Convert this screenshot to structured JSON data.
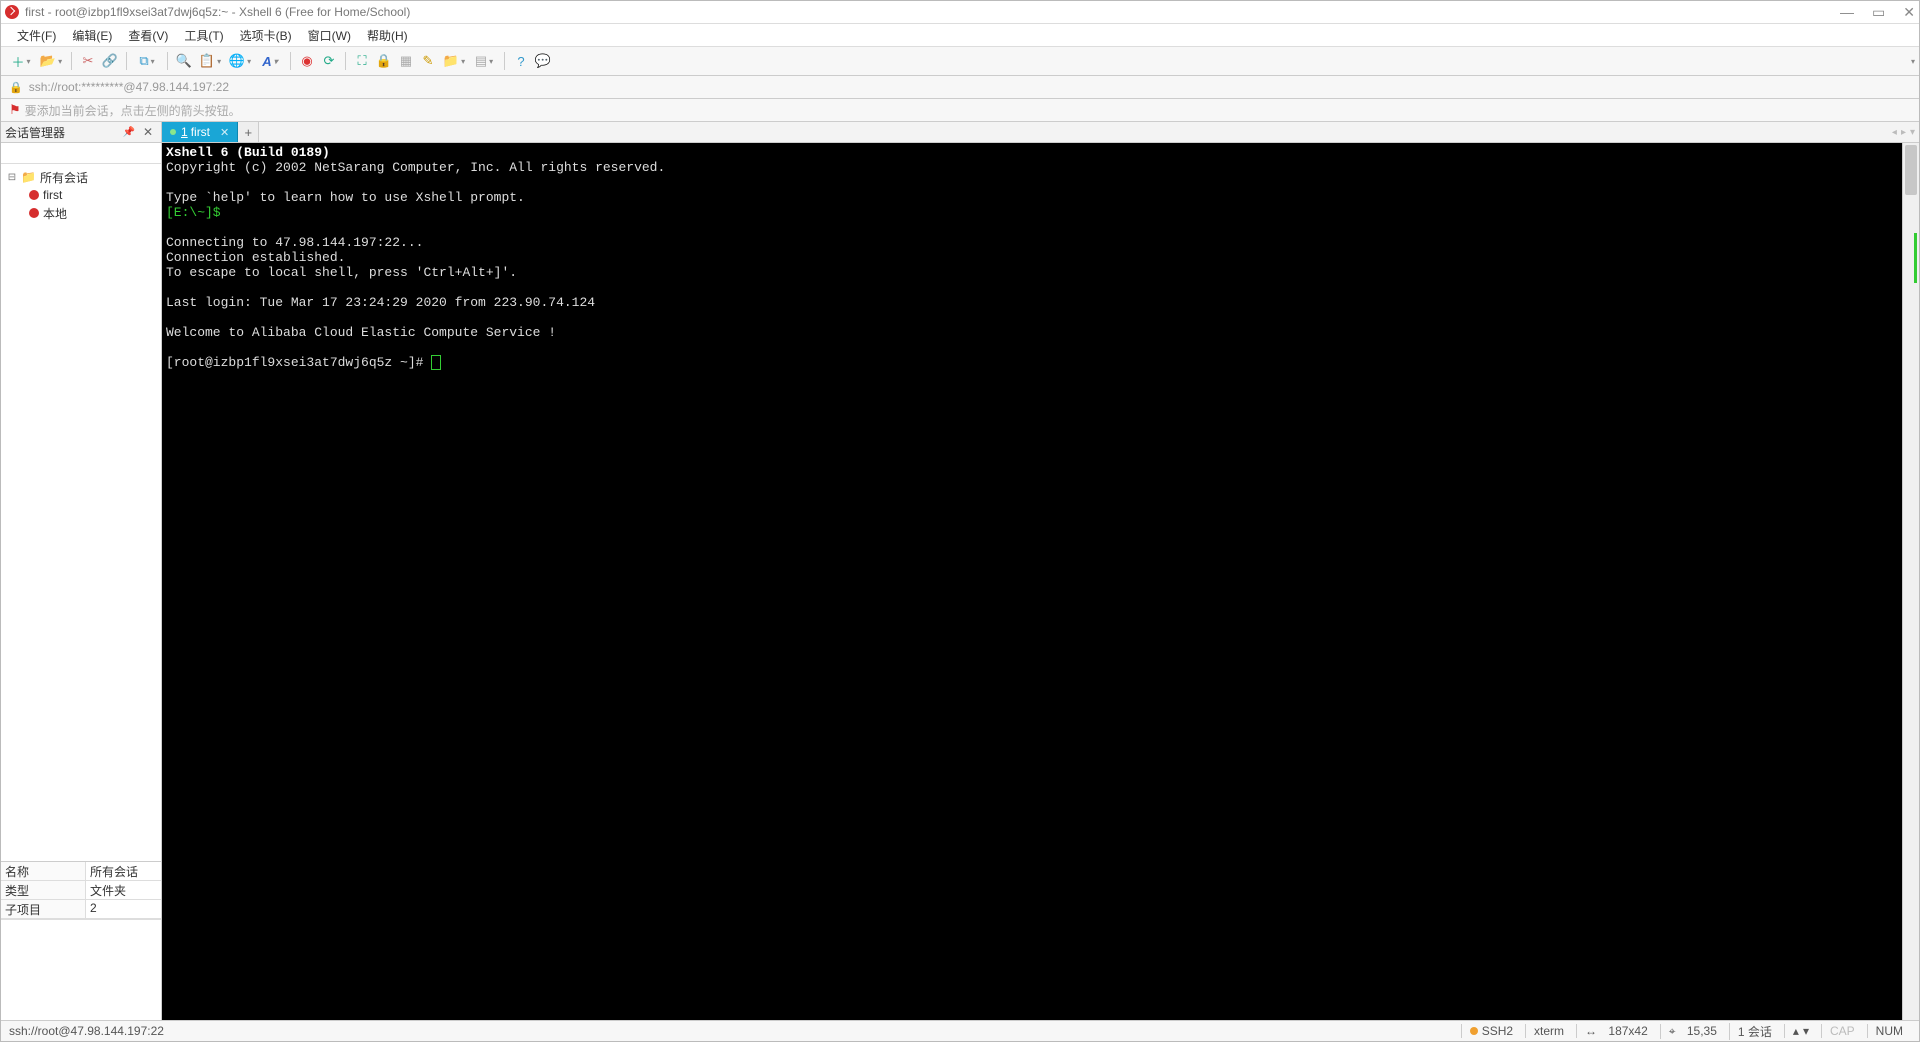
{
  "title": "first - root@izbp1fl9xsei3at7dwj6q5z:~ - Xshell 6 (Free for Home/School)",
  "menus": [
    "文件(F)",
    "编辑(E)",
    "查看(V)",
    "工具(T)",
    "选项卡(B)",
    "窗口(W)",
    "帮助(H)"
  ],
  "address": "ssh://root:*********@47.98.144.197:22",
  "hint": "要添加当前会话，点击左侧的箭头按钮。",
  "sidebar": {
    "title": "会话管理器",
    "root": "所有会话",
    "items": [
      "first",
      "本地"
    ]
  },
  "props": [
    {
      "k": "名称",
      "v": "所有会话"
    },
    {
      "k": "类型",
      "v": "文件夹"
    },
    {
      "k": "子项目",
      "v": "2"
    }
  ],
  "tab": {
    "num": "1",
    "label": "first"
  },
  "terminal": {
    "l1": "Xshell 6 (Build 0189)",
    "l2": "Copyright (c) 2002 NetSarang Computer, Inc. All rights reserved.",
    "l3": "",
    "l4": "Type `help' to learn how to use Xshell prompt.",
    "l5": "[E:\\~]$",
    "l6": "",
    "l7": "Connecting to 47.98.144.197:22...",
    "l8": "Connection established.",
    "l9": "To escape to local shell, press 'Ctrl+Alt+]'.",
    "l10": "",
    "l11": "Last login: Tue Mar 17 23:24:29 2020 from 223.90.74.124",
    "l12": "",
    "l13": "Welcome to Alibaba Cloud Elastic Compute Service !",
    "l14": "",
    "prompt": "[root@izbp1fl9xsei3at7dwj6q5z ~]# "
  },
  "status": {
    "left": "ssh://root@47.98.144.197:22",
    "ssh": "SSH2",
    "term": "xterm",
    "size": "187x42",
    "pos": "15,35",
    "sess": "1 会话",
    "cap": "CAP",
    "num": "NUM"
  }
}
